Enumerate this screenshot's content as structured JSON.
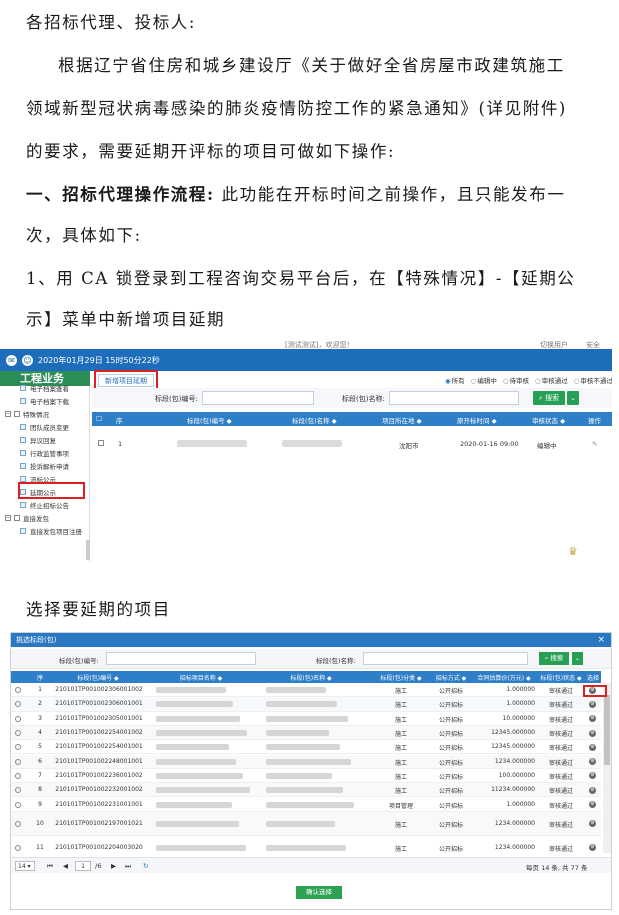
{
  "doc": {
    "p1": "各招标代理、投标人:",
    "p2": "根据辽宁省住房和城乡建设厅《关于做好全省房屋市政建筑施工",
    "p3": "领域新型冠状病毒感染的肺炎疫情防控工作的紧急通知》(详见附件)",
    "p4": "的要求，需要延期开评标的项目可做如下操作:",
    "p5_bold": "一、招标代理操作流程:",
    "p5_rest": " 此功能在开标时间之前操作，且只能发布一",
    "p6": "次，具体如下:",
    "p7": "1、用 CA 锁登录到工程咨询交易平台后，在【特殊情况】-【延期公",
    "p8": "示】菜单中新增项目延期",
    "p9": "选择要延期的项目"
  },
  "shot1": {
    "top_center": "[测试测试]，欢迎您！",
    "top_right_1": "切换用户",
    "top_right_2": "安全",
    "datetime": "2020年01月29日 15时50分22秒",
    "section_title": "工程业务",
    "add_button": "新增项目延期",
    "filters": [
      "所有",
      "编辑中",
      "待审核",
      "审核通过",
      "审核不通过"
    ],
    "sidebar": {
      "item_top": "电子档案查看",
      "item_download": "电子档案下载",
      "group_special": "特殊情况",
      "items_special": [
        "团队成员变更",
        "异议回复",
        "行政监管事项",
        "投诉解析申请",
        "流标公示",
        "延期公示",
        "终止招标公告"
      ],
      "group_direct": "直接发包",
      "items_direct": [
        "直接发包项目注册"
      ]
    },
    "search": {
      "section_no_label": "标段(包)编号:",
      "section_name_label": "标段(包)名称:",
      "search_button": "搜索"
    },
    "table": {
      "headers": [
        "序",
        "标段(包)编号 ◆",
        "标段(包)名称 ◆",
        "项目所在地 ◆",
        "原开标时间 ◆",
        "审核状态 ◆",
        "操作"
      ],
      "row": {
        "no": "1",
        "location": "沈阳市",
        "time": "2020-01-16 09:00",
        "status": "编辑中"
      }
    }
  },
  "shot2": {
    "title": "挑选标段(包)",
    "close": "×",
    "search": {
      "section_no_label": "标段(包)编号:",
      "section_name_label": "标段(包)名称:",
      "search_button": "搜索"
    },
    "headers": [
      "序",
      "标段(包)编号 ◆",
      "招标项目名称 ◆",
      "标段(包)名称 ◆",
      "标段(包)分类 ◆",
      "招标方式 ◆",
      "合同估算价(万元) ◆",
      "标段(包)状态 ◆",
      "选择"
    ],
    "rows": [
      {
        "no": "1",
        "code": "210101TP001002306001002",
        "category": "施工",
        "method": "公开招标",
        "price": "1.000000",
        "status": "审核通过"
      },
      {
        "no": "2",
        "code": "210101TP001002306001001",
        "category": "施工",
        "method": "公开招标",
        "price": "1.000000",
        "status": "审核通过"
      },
      {
        "no": "3",
        "code": "210101TP001002305001001",
        "category": "施工",
        "method": "公开招标",
        "price": "10.000000",
        "status": "审核通过"
      },
      {
        "no": "4",
        "code": "210101TP001002254001002",
        "category": "施工",
        "method": "公开招标",
        "price": "12345.000000",
        "status": "审核通过"
      },
      {
        "no": "5",
        "code": "210101TP001002254001001",
        "category": "施工",
        "method": "公开招标",
        "price": "12345.000000",
        "status": "审核通过"
      },
      {
        "no": "6",
        "code": "210101TP001002248001001",
        "category": "施工",
        "method": "公开招标",
        "price": "1234.000000",
        "status": "审核通过"
      },
      {
        "no": "7",
        "code": "210101TP001002236001002",
        "category": "施工",
        "method": "公开招标",
        "price": "100.000000",
        "status": "审核通过"
      },
      {
        "no": "8",
        "code": "210101TP001002232001002",
        "category": "施工",
        "method": "公开招标",
        "price": "11234.000000",
        "status": "审核通过"
      },
      {
        "no": "9",
        "code": "210101TP001002231001001",
        "category": "项目管理",
        "method": "公开招标",
        "price": "1.000000",
        "status": "审核通过"
      },
      {
        "no": "10",
        "code": "210101TP001002197001021",
        "category": "施工",
        "method": "公开招标",
        "price": "1234.000000",
        "status": "审核通过"
      },
      {
        "no": "11",
        "code": "210101TP001002204003020",
        "category": "施工",
        "method": "公开招标",
        "price": "1234.000000",
        "status": "审核通过"
      }
    ],
    "pager": {
      "page_size": "14",
      "current": "1",
      "total_pages": "/6",
      "summary": "每页 14 条, 共 77 条"
    },
    "confirm_button": "确认选择"
  }
}
